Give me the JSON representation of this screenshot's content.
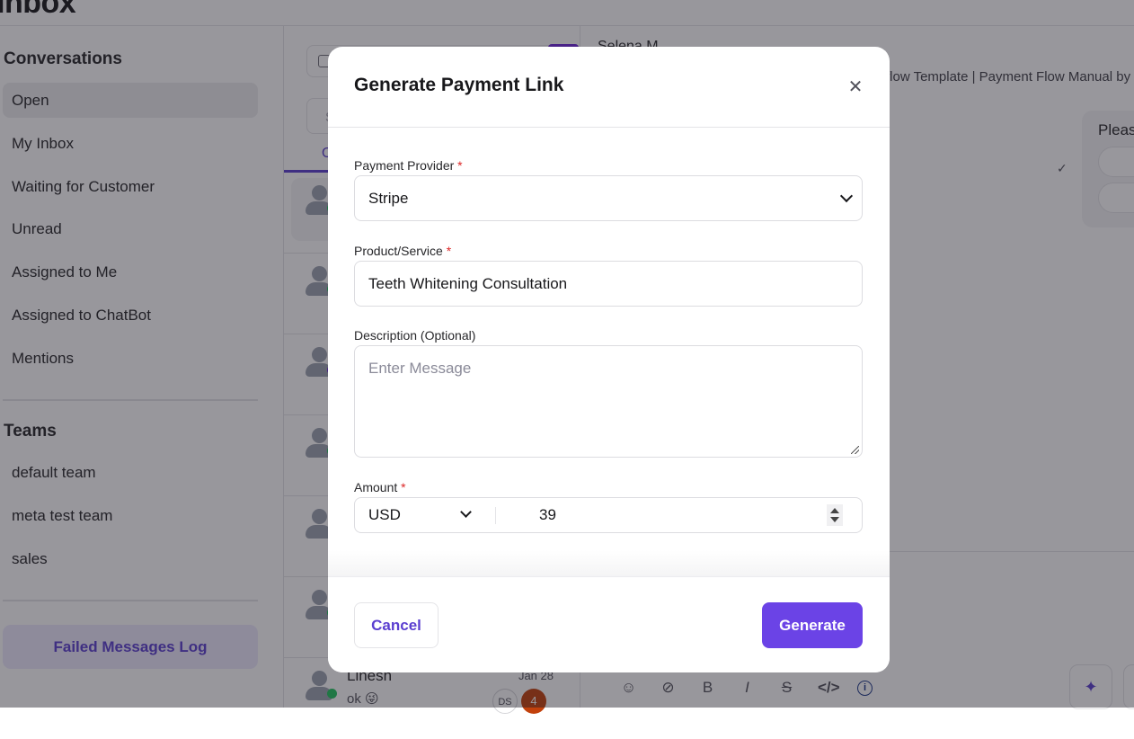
{
  "header": {
    "title": "Inbox"
  },
  "sidebar": {
    "conversations_title": "Conversations",
    "items": [
      {
        "label": "Open",
        "active": true
      },
      {
        "label": "My Inbox"
      },
      {
        "label": "Waiting for Customer"
      },
      {
        "label": "Unread"
      },
      {
        "label": "Assigned to Me"
      },
      {
        "label": "Assigned to ChatBot"
      },
      {
        "label": "Mentions"
      }
    ],
    "teams_title": "Teams",
    "teams": [
      {
        "label": "default team"
      },
      {
        "label": "meta test team"
      },
      {
        "label": "sales"
      }
    ],
    "failed_log_label": "Failed Messages Log"
  },
  "conversation_list": {
    "search_placeholder": "S",
    "active_tab": "O",
    "last_item": {
      "name": "Linesh",
      "date": "Jan 28",
      "preview": "ok 😜",
      "agent_initials": "DS",
      "unread_count": "4"
    }
  },
  "chat": {
    "contact_name": "Selena M",
    "subtitle": "flow Template | Payment Flow Manual by",
    "template_card_text": "Pleas",
    "check": "✓",
    "toolbar": [
      "emoji-icon",
      "link-icon",
      "bold-icon",
      "italic-icon",
      "strikethrough-icon",
      "code-icon",
      "info-icon"
    ]
  },
  "modal": {
    "title": "Generate Payment Link",
    "close_glyph": "✕",
    "provider": {
      "label": "Payment Provider",
      "required": "*",
      "value": "Stripe"
    },
    "product": {
      "label": "Product/Service",
      "required": "*",
      "value": "Teeth Whitening Consultation"
    },
    "description": {
      "label": "Description (Optional)",
      "placeholder": "Enter Message",
      "value": ""
    },
    "amount": {
      "label": "Amount",
      "required": "*",
      "currency": "USD",
      "value": "39"
    },
    "cancel_label": "Cancel",
    "generate_label": "Generate"
  },
  "colors": {
    "accent": "#6b43e6",
    "required": "#dc2626",
    "status_online": "#22c55e"
  }
}
